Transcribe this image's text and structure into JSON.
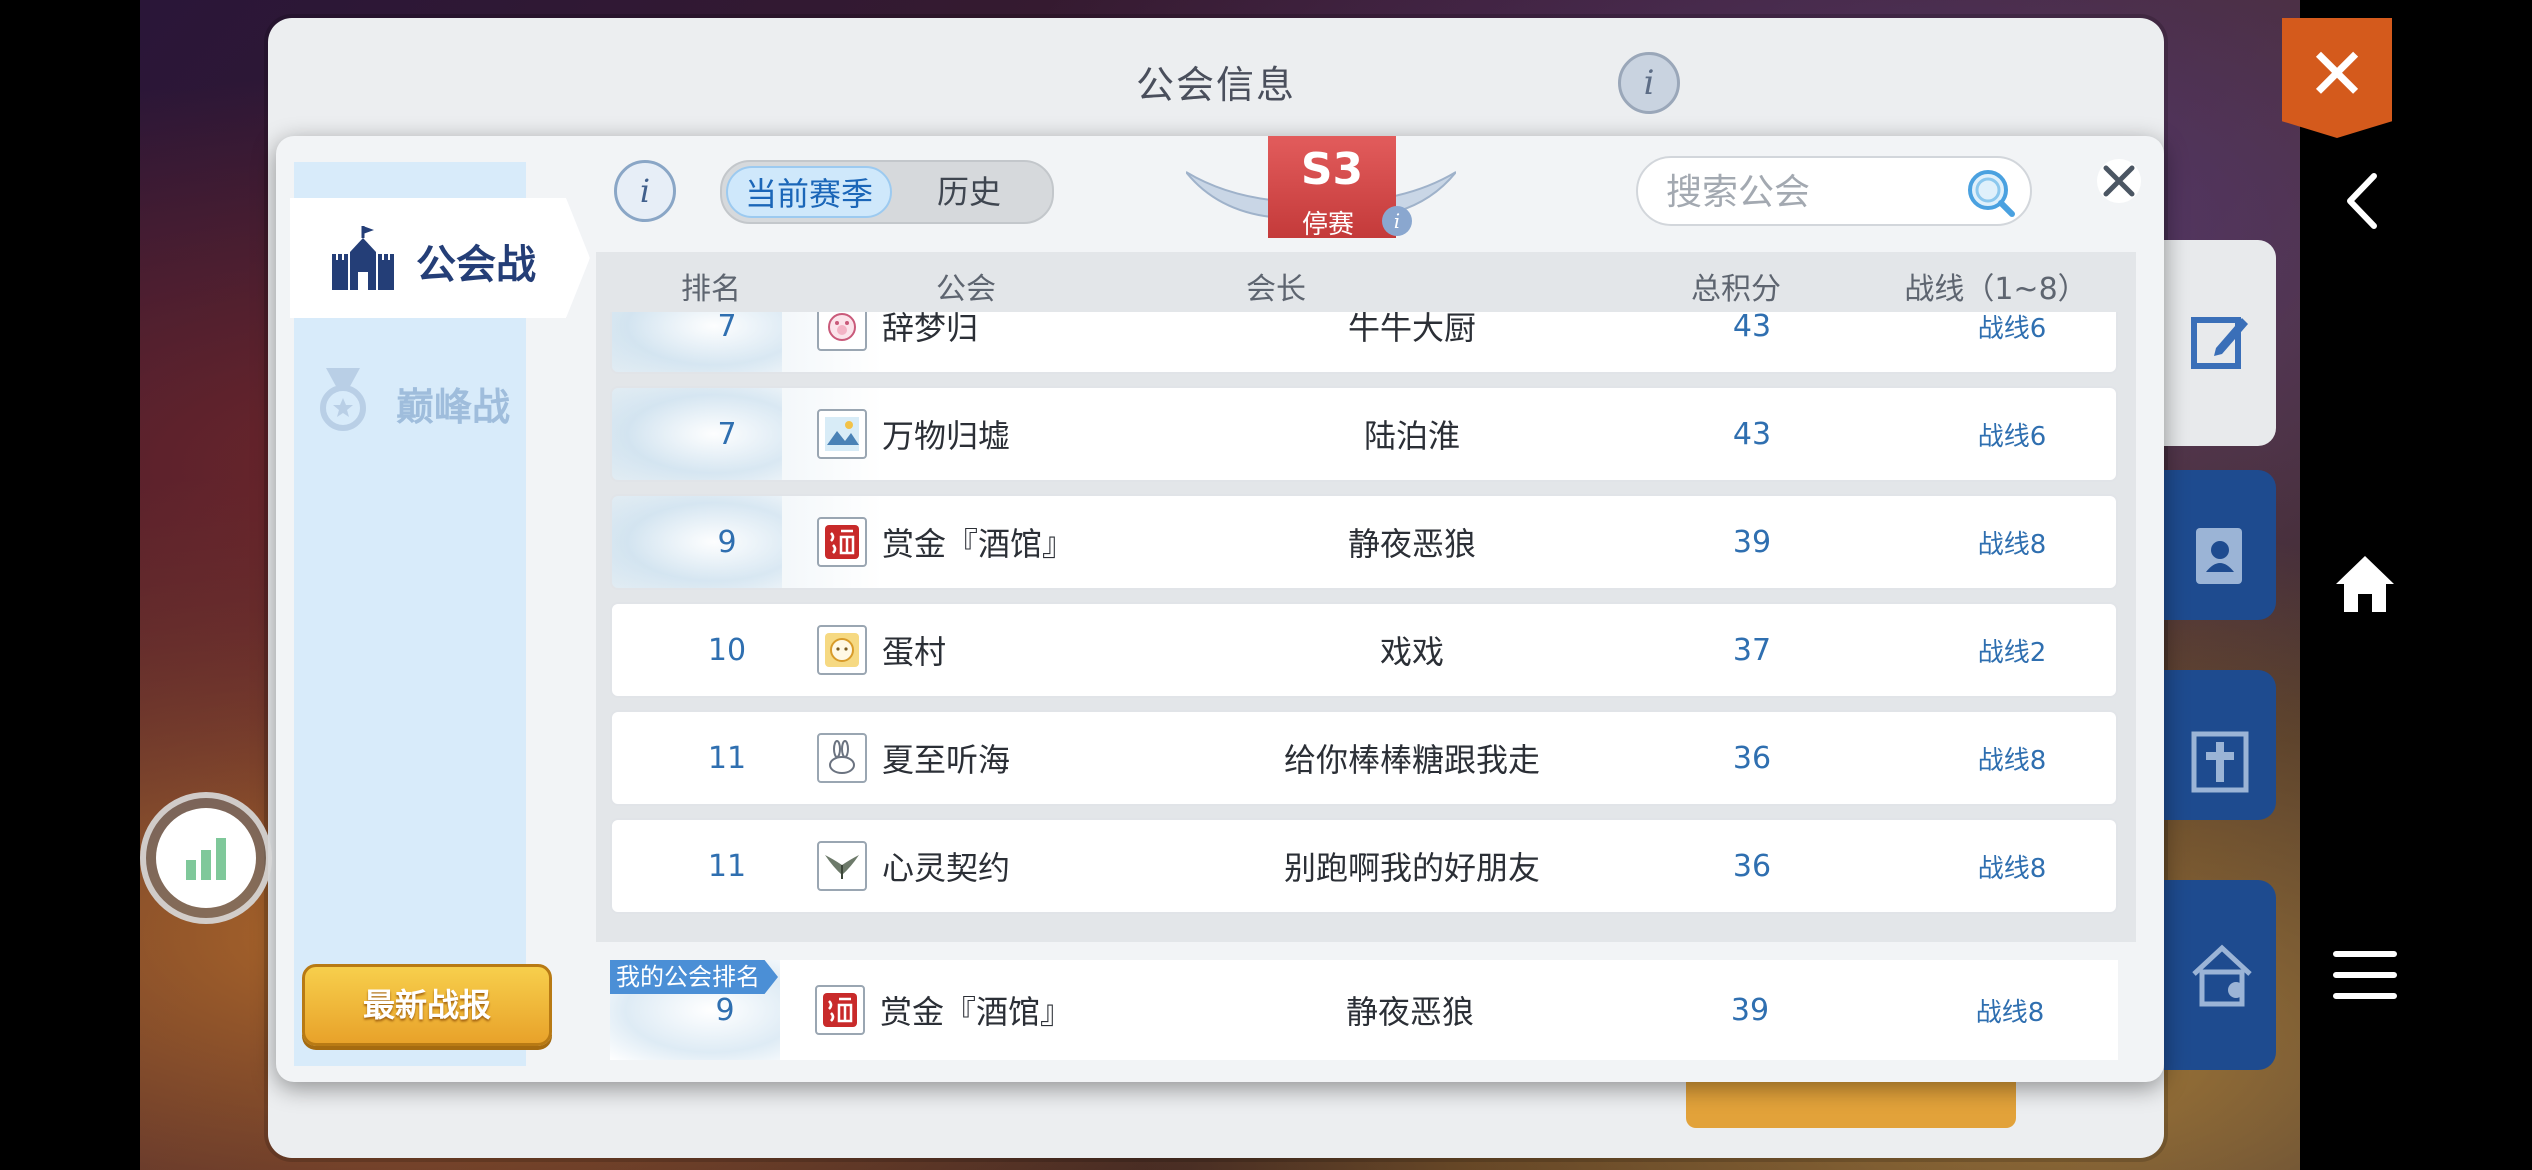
{
  "background_panel": {
    "title": "公会信息"
  },
  "modal": {
    "sidebar": {
      "tabs": [
        {
          "label": "公会战",
          "active": true
        },
        {
          "label": "巅峰战",
          "active": false
        }
      ],
      "latest_report_label": "最新战报"
    },
    "season_toggle": {
      "current_label": "当前赛季",
      "history_label": "历史"
    },
    "season_badge": {
      "season": "S3",
      "status": "停赛"
    },
    "search": {
      "placeholder": "搜索公会",
      "value": ""
    },
    "table": {
      "columns": [
        "排名",
        "公会",
        "会长",
        "总积分",
        "战线（1~8）"
      ],
      "rows": [
        {
          "rank": "7",
          "guild": "辞梦归",
          "leader": "牛牛大厨",
          "score": "43",
          "line": "战线6",
          "emblem": "pig-emblem-icon",
          "top": true
        },
        {
          "rank": "7",
          "guild": "万物归墟",
          "leader": "陆泊淮",
          "score": "43",
          "line": "战线6",
          "emblem": "landscape-emblem-icon",
          "top": true
        },
        {
          "rank": "9",
          "guild": "赏金『酒馆』",
          "leader": "静夜恶狼",
          "score": "39",
          "line": "战线8",
          "emblem": "wine-seal-emblem-icon",
          "top": true
        },
        {
          "rank": "10",
          "guild": "蛋村",
          "leader": "戏戏",
          "score": "37",
          "line": "战线2",
          "emblem": "egg-emblem-icon",
          "top": false
        },
        {
          "rank": "11",
          "guild": "夏至听海",
          "leader": "给你棒棒糖跟我走",
          "score": "36",
          "line": "战线8",
          "emblem": "rabbit-emblem-icon",
          "top": false
        },
        {
          "rank": "11",
          "guild": "心灵契约",
          "leader": "别跑啊我的好朋友",
          "score": "36",
          "line": "战线8",
          "emblem": "wings-emblem-icon",
          "top": false
        }
      ]
    },
    "my_guild": {
      "tag": "我的公会排名",
      "rank": "9",
      "guild": "赏金『酒馆』",
      "leader": "静夜恶狼",
      "score": "39",
      "line": "战线8",
      "emblem": "wine-seal-emblem-icon"
    }
  },
  "colors": {
    "accent_blue": "#2f6fb0",
    "sidebar_bg": "#d8ebfa",
    "season_red": "#d24a4a",
    "report_button": "#f0b83a",
    "close_orange": "#d45a1c"
  }
}
